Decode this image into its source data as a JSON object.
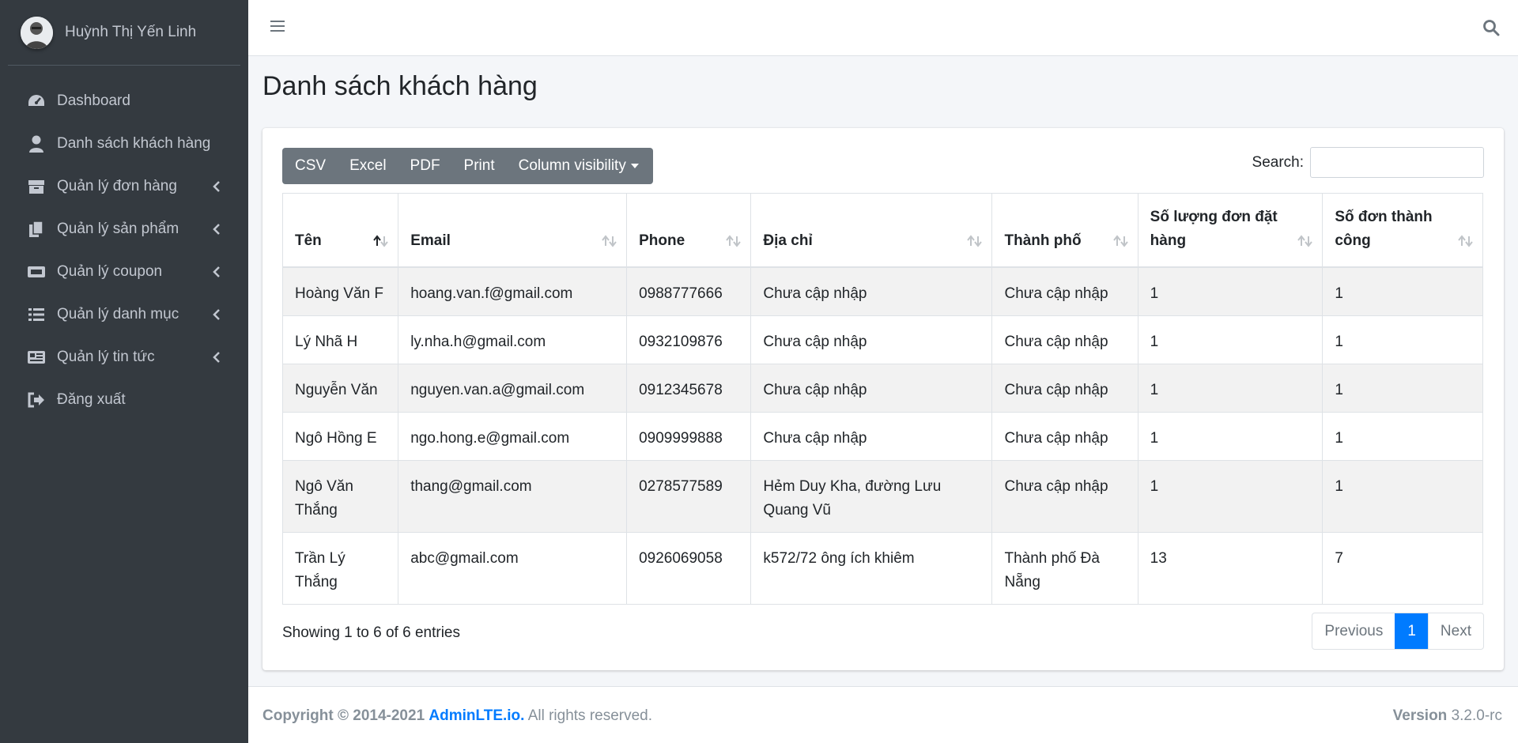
{
  "user": {
    "name": "Huỳnh Thị Yến Linh"
  },
  "sidebar": {
    "items": [
      {
        "label": "Dashboard",
        "icon": "tachometer-icon",
        "has_children": false
      },
      {
        "label": "Danh sách khách hàng",
        "icon": "user-icon",
        "has_children": false
      },
      {
        "label": "Quản lý đơn hàng",
        "icon": "box-icon",
        "has_children": true
      },
      {
        "label": "Quản lý sản phẩm",
        "icon": "copy-icon",
        "has_children": true
      },
      {
        "label": "Quản lý coupon",
        "icon": "ticket-icon",
        "has_children": true
      },
      {
        "label": "Quản lý danh mục",
        "icon": "list-icon",
        "has_children": true
      },
      {
        "label": "Quản lý tin tức",
        "icon": "newspaper-icon",
        "has_children": true
      },
      {
        "label": "Đăng xuất",
        "icon": "sign-out-icon",
        "has_children": false
      }
    ]
  },
  "page": {
    "title": "Danh sách khách hàng"
  },
  "toolbar": {
    "buttons": [
      "CSV",
      "Excel",
      "PDF",
      "Print",
      "Column visibility"
    ],
    "search_label": "Search:",
    "search_value": ""
  },
  "table": {
    "columns": [
      "Tên",
      "Email",
      "Phone",
      "Địa chỉ",
      "Thành phố",
      "Số lượng đơn đặt hàng",
      "Số đơn thành công"
    ],
    "rows": [
      [
        "Hoàng Văn F",
        "hoang.van.f@gmail.com",
        "0988777666",
        "Chưa cập nhập",
        "Chưa cập nhập",
        "1",
        "1"
      ],
      [
        "Lý Nhã H",
        "ly.nha.h@gmail.com",
        "0932109876",
        "Chưa cập nhập",
        "Chưa cập nhập",
        "1",
        "1"
      ],
      [
        "Nguyễn Văn",
        "nguyen.van.a@gmail.com",
        "0912345678",
        "Chưa cập nhập",
        "Chưa cập nhập",
        "1",
        "1"
      ],
      [
        "Ngô Hồng E",
        "ngo.hong.e@gmail.com",
        "0909999888",
        "Chưa cập nhập",
        "Chưa cập nhập",
        "1",
        "1"
      ],
      [
        "Ngô Văn Thắng",
        "thang@gmail.com",
        "0278577589",
        "Hẻm Duy Kha, đường Lưu Quang Vũ",
        "Chưa cập nhập",
        "1",
        "1"
      ],
      [
        "Trần Lý Thắng",
        "abc@gmail.com",
        "0926069058",
        "k572/72 ông ích khiêm",
        "Thành phố Đà Nẵng",
        "13",
        "7"
      ]
    ]
  },
  "pagination": {
    "info": "Showing 1 to 6 of 6 entries",
    "previous": "Previous",
    "current": "1",
    "next": "Next"
  },
  "footer": {
    "copyright": "Copyright © 2014-2021",
    "brand": "AdminLTE.io.",
    "rights": "All rights reserved.",
    "version_label": "Version",
    "version": "3.2.0-rc"
  },
  "colors": {
    "sidebar_bg": "#343a40",
    "accent": "#007bff",
    "button_bg": "#6c757d"
  }
}
